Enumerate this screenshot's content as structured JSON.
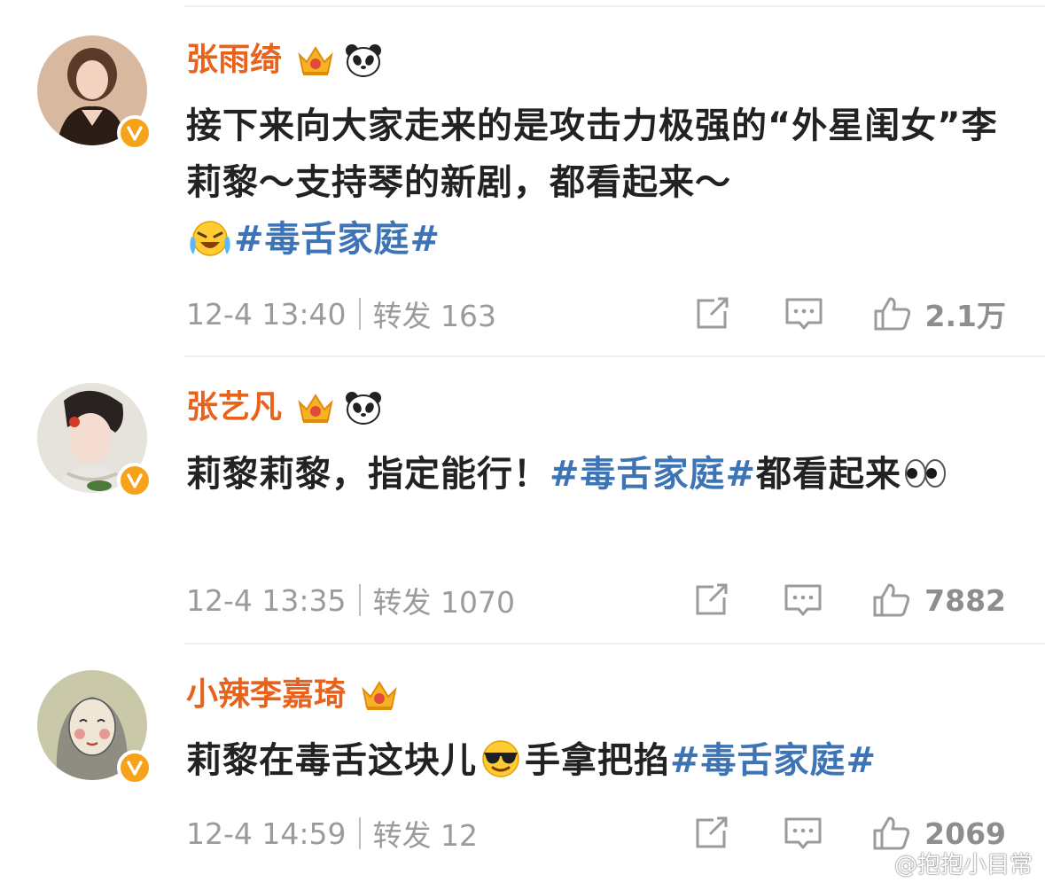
{
  "comments": [
    {
      "name": "张雨绮",
      "badges": [
        "crown-icon",
        "panda-icon"
      ],
      "text_parts": [
        "接下来向大家走来的是攻击力极强的“外星闺女”李莉黎～支持琴的新剧，都看起来～"
      ],
      "emoji": "laugh-tears-emoji",
      "topic": "#毒舌家庭#",
      "time": "12-4 13:40",
      "repost_label": "转发 163",
      "likes": "2.1万"
    },
    {
      "name": "张艺凡",
      "badges": [
        "crown-icon",
        "panda-icon"
      ],
      "text_before": "莉黎莉黎，指定能行！",
      "topic": "#毒舌家庭#",
      "text_after": "都看起来",
      "emoji": "eyes-emoji",
      "time": "12-4 13:35",
      "repost_label": "转发 1070",
      "likes": "7882"
    },
    {
      "name": "小辣李嘉琦",
      "badges": [
        "crown-icon"
      ],
      "text_before": "莉黎在毒舌这块儿",
      "emoji": "sunglasses-emoji",
      "text_after": "手拿把掐",
      "topic": "#毒舌家庭#",
      "time": "12-4 14:59",
      "repost_label": "转发 12",
      "likes": "2069"
    }
  ],
  "watermark": "@抱抱小目常",
  "colors": {
    "name": "#e8621b",
    "topic": "#3d74b6",
    "meta": "#9b9b9b",
    "text": "#222222",
    "verified_badge": "#f7a21b"
  }
}
